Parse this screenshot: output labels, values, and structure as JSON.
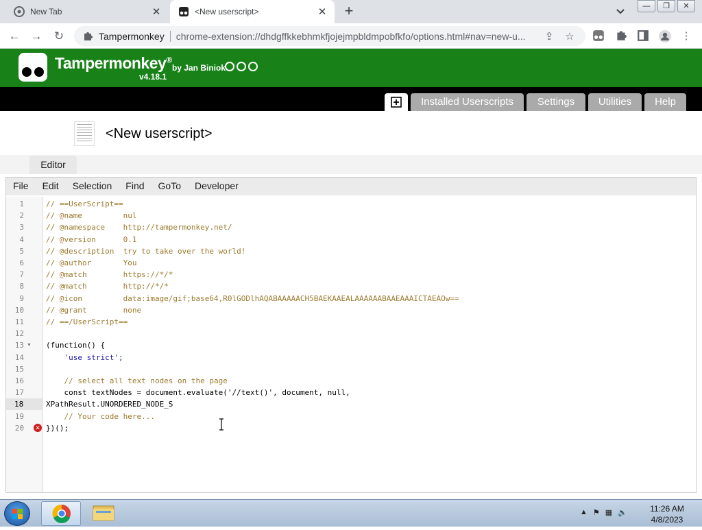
{
  "browser": {
    "tabs": [
      {
        "title": "New Tab",
        "active": false
      },
      {
        "title": "<New userscript>",
        "active": true
      }
    ],
    "site_name": "Tampermonkey",
    "url": "chrome-extension://dhdgffkkebhmkfjojejmpbldmpobfkfo/options.html#nav=new-u..."
  },
  "tampermonkey": {
    "brand": "Tampermonkey",
    "registered": "®",
    "by": "by Jan Biniok",
    "version": "v4.18.1",
    "nav": {
      "installed": "Installed Userscripts",
      "settings": "Settings",
      "utilities": "Utilities",
      "help": "Help"
    },
    "script_title": "<New userscript>",
    "editor_tab": "Editor"
  },
  "editor": {
    "menu": [
      "File",
      "Edit",
      "Selection",
      "Find",
      "GoTo",
      "Developer"
    ],
    "current_line": "18",
    "lines": [
      {
        "n": "1",
        "text": "// ==UserScript=="
      },
      {
        "n": "2",
        "text": "// @name         nul"
      },
      {
        "n": "3",
        "text": "// @namespace    http://tampermonkey.net/"
      },
      {
        "n": "4",
        "text": "// @version      0.1"
      },
      {
        "n": "5",
        "text": "// @description  try to take over the world!"
      },
      {
        "n": "6",
        "text": "// @author       You"
      },
      {
        "n": "7",
        "text": "// @match        https://*/*"
      },
      {
        "n": "8",
        "text": "// @match        http://*/*"
      },
      {
        "n": "9",
        "text": "// @icon         data:image/gif;base64,R0lGODlhAQABAAAAACH5BAEKAAEALAAAAAABAAEAAAICTAEAOw=="
      },
      {
        "n": "10",
        "text": "// @grant        none"
      },
      {
        "n": "11",
        "text": "// ==/UserScript=="
      },
      {
        "n": "12",
        "text": ""
      },
      {
        "n": "13",
        "text": "(function() {"
      },
      {
        "n": "14",
        "text": "    'use strict';"
      },
      {
        "n": "15",
        "text": ""
      },
      {
        "n": "16",
        "text": "    // select all text nodes on the page"
      },
      {
        "n": "17",
        "text": "    const textNodes = document.evaluate('//text()', document, null,"
      },
      {
        "n": "18",
        "text": "XPathResult.UNORDERED_NODE_S"
      },
      {
        "n": "19",
        "text": "    // Your code here..."
      },
      {
        "n": "20",
        "text": "})();"
      }
    ]
  },
  "taskbar": {
    "time": "11:26 AM",
    "date": "4/8/2023"
  }
}
